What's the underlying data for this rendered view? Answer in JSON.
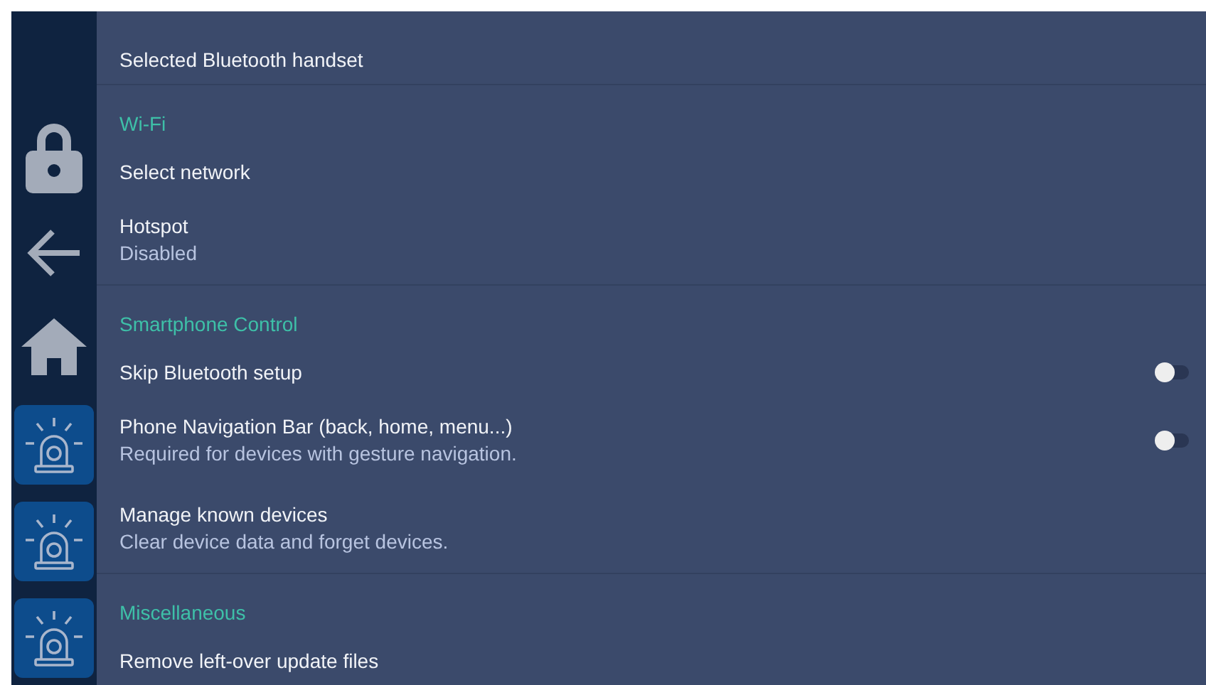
{
  "sections": [
    {
      "items": [
        {
          "kind": "item",
          "title": "Selected Bluetooth handset"
        }
      ]
    },
    {
      "header": "Wi-Fi",
      "items": [
        {
          "kind": "item",
          "title": "Select network"
        },
        {
          "kind": "item",
          "title": "Hotspot",
          "subtitle": "Disabled"
        }
      ]
    },
    {
      "header": "Smartphone Control",
      "items": [
        {
          "kind": "toggle",
          "title": "Skip Bluetooth setup",
          "on": false
        },
        {
          "kind": "toggle",
          "title": "Phone Navigation Bar (back, home, menu...)",
          "subtitle": "Required for devices with gesture navigation.",
          "on": false
        },
        {
          "kind": "item",
          "title": "Manage known devices",
          "subtitle": "Clear device data and forget devices."
        }
      ]
    },
    {
      "header": "Miscellaneous",
      "items": [
        {
          "kind": "item",
          "title": "Remove left-over update files"
        }
      ]
    }
  ]
}
